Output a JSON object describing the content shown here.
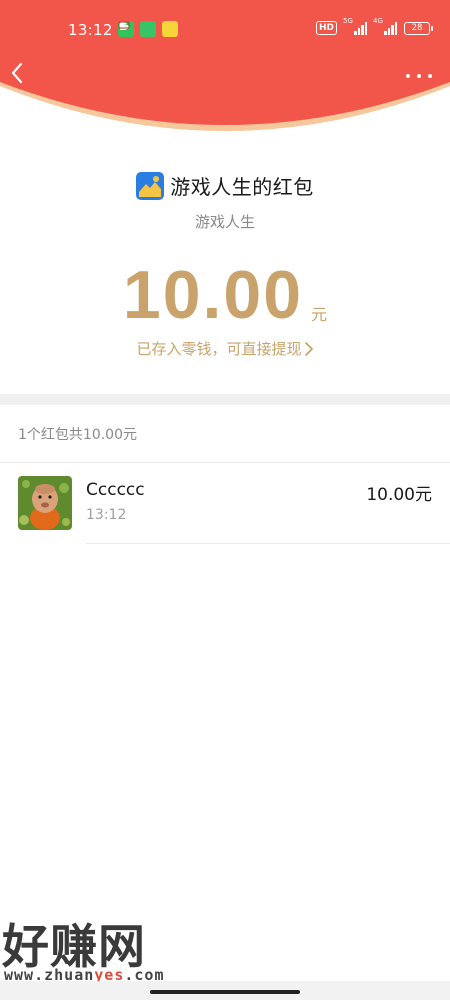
{
  "status_bar": {
    "time": "13:12",
    "notifications": [
      "wechat-icon",
      "android-icon",
      "yellow-app-icon"
    ],
    "hd_label": "HD",
    "signal_1_label": "5G",
    "signal_2_label": "4G",
    "battery": "28"
  },
  "header": {
    "back_icon": "chevron-left-icon",
    "more_icon": "more-dots-icon",
    "colors": {
      "red": "#f2564a",
      "rim": "#f6c79a"
    }
  },
  "sender": {
    "title": "游戏人生的红包",
    "subtitle": "游戏人生",
    "avatar_icon": "blue-yellow-app-icon"
  },
  "amount": {
    "value": "10.00",
    "unit": "元",
    "deposit_text": "已存入零钱，可直接提现",
    "gold_color": "#c9a36b"
  },
  "summary": "1个红包共10.00元",
  "receivers": [
    {
      "name": "Cccccc",
      "time": "13:12",
      "amount": "10.00元"
    }
  ],
  "watermark": {
    "logo": "好赚网",
    "url_prefix": "www.zhuan",
    "url_highlight": "yes",
    "url_suffix": ".com"
  }
}
